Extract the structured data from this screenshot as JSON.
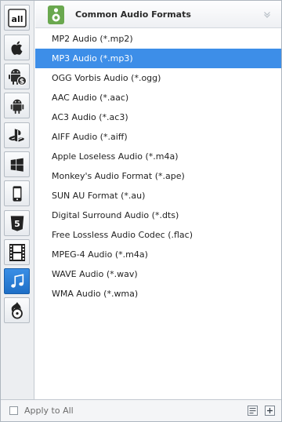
{
  "categories": [
    {
      "name": "all-formats",
      "label": "all",
      "active": false
    },
    {
      "name": "apple",
      "active": false
    },
    {
      "name": "android-store",
      "active": false
    },
    {
      "name": "android",
      "active": false
    },
    {
      "name": "playstation",
      "active": false
    },
    {
      "name": "windows",
      "active": false
    },
    {
      "name": "mobile-phone",
      "active": false
    },
    {
      "name": "html5",
      "active": false
    },
    {
      "name": "video-film",
      "active": false
    },
    {
      "name": "audio-music",
      "active": true
    },
    {
      "name": "burn-disc",
      "active": false
    }
  ],
  "header": {
    "title": "Common Audio Formats",
    "icon": "speaker-icon"
  },
  "formats": [
    {
      "label": "MP2 Audio (*.mp2)",
      "selected": false
    },
    {
      "label": "MP3 Audio (*.mp3)",
      "selected": true
    },
    {
      "label": "OGG Vorbis Audio (*.ogg)",
      "selected": false
    },
    {
      "label": "AAC Audio (*.aac)",
      "selected": false
    },
    {
      "label": "AC3 Audio (*.ac3)",
      "selected": false
    },
    {
      "label": "AIFF Audio (*.aiff)",
      "selected": false
    },
    {
      "label": "Apple Loseless Audio (*.m4a)",
      "selected": false
    },
    {
      "label": "Monkey's Audio Format (*.ape)",
      "selected": false
    },
    {
      "label": "SUN AU Format (*.au)",
      "selected": false
    },
    {
      "label": "Digital Surround Audio (*.dts)",
      "selected": false
    },
    {
      "label": "Free Lossless Audio Codec (.flac)",
      "selected": false
    },
    {
      "label": "MPEG-4 Audio (*.m4a)",
      "selected": false
    },
    {
      "label": "WAVE Audio (*.wav)",
      "selected": false
    },
    {
      "label": "WMA Audio (*.wma)",
      "selected": false
    }
  ],
  "footer": {
    "apply_to_all_label": "Apply to All",
    "apply_to_all_checked": false
  },
  "colors": {
    "selection": "#3d8ee8",
    "active_category": "#2a7ed6",
    "header_icon": "#6aa84f"
  }
}
